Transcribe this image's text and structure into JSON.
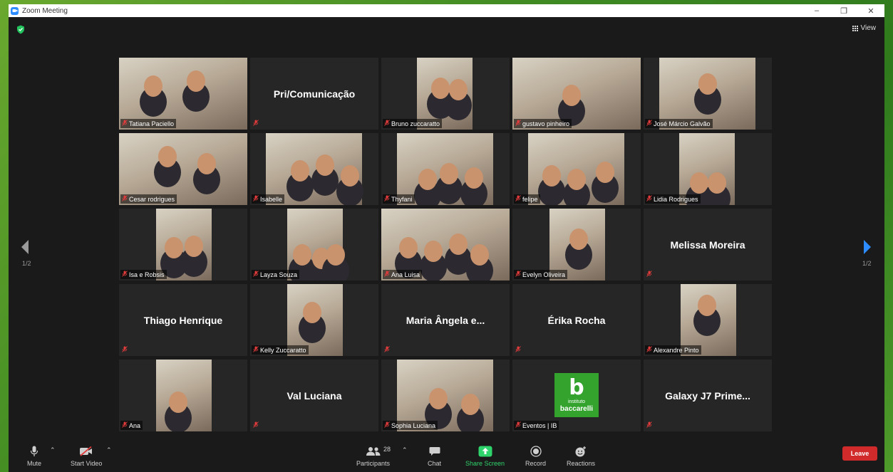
{
  "window": {
    "title": "Zoom Meeting",
    "minimize": "–",
    "maximize": "❐",
    "close": "✕"
  },
  "header": {
    "view_label": "View"
  },
  "pagination": {
    "left": "1/2",
    "right": "1/2"
  },
  "tiles": [
    {
      "name": "Tatiana Paciello",
      "type": "video",
      "active": true
    },
    {
      "name": "Pri/Comunicação",
      "type": "name"
    },
    {
      "name": "Bruno zuccaratto",
      "type": "video"
    },
    {
      "name": "gustavo pinheiro",
      "type": "video"
    },
    {
      "name": "José Márcio Galvão",
      "type": "video"
    },
    {
      "name": "Cesar rodrigues",
      "type": "video"
    },
    {
      "name": "Isabelle",
      "type": "video"
    },
    {
      "name": "Thyfani",
      "type": "video"
    },
    {
      "name": "felipe",
      "type": "video"
    },
    {
      "name": "Lidia Rodrigues",
      "type": "video"
    },
    {
      "name": "Isa e Robsis",
      "type": "video"
    },
    {
      "name": "Layza Souza",
      "type": "video"
    },
    {
      "name": "Ana Luisa",
      "type": "video"
    },
    {
      "name": "Evelyn Oliveira",
      "type": "video"
    },
    {
      "name": "Melissa Moreira",
      "type": "name"
    },
    {
      "name": "Thiago Henrique",
      "type": "name"
    },
    {
      "name": "Kelly Zuccaratto",
      "type": "video"
    },
    {
      "name": "Maria Ângela e...",
      "type": "name"
    },
    {
      "name": "Érika Rocha",
      "type": "name"
    },
    {
      "name": "Alexandre Pinto",
      "type": "video"
    },
    {
      "name": "Ana",
      "type": "video"
    },
    {
      "name": "Val Luciana",
      "type": "name"
    },
    {
      "name": "Sophia Luciana",
      "type": "video"
    },
    {
      "name": "Eventos | IB",
      "type": "logo"
    },
    {
      "name": "Galaxy J7 Prime...",
      "type": "name"
    }
  ],
  "logo": {
    "symbol": "b",
    "small": "instituto",
    "text": "baccarelli",
    "color": "#33a32e"
  },
  "toolbar": {
    "mute": "Mute",
    "start_video": "Start Video",
    "participants": "Participants",
    "participants_count": "28",
    "chat": "Chat",
    "share_screen": "Share Screen",
    "record": "Record",
    "reactions": "Reactions",
    "leave": "Leave"
  },
  "colors": {
    "leave": "#d02a2a",
    "share": "#2fd36b",
    "active_border": "#c8d93f",
    "nav_arrow": "#2d8cff"
  }
}
